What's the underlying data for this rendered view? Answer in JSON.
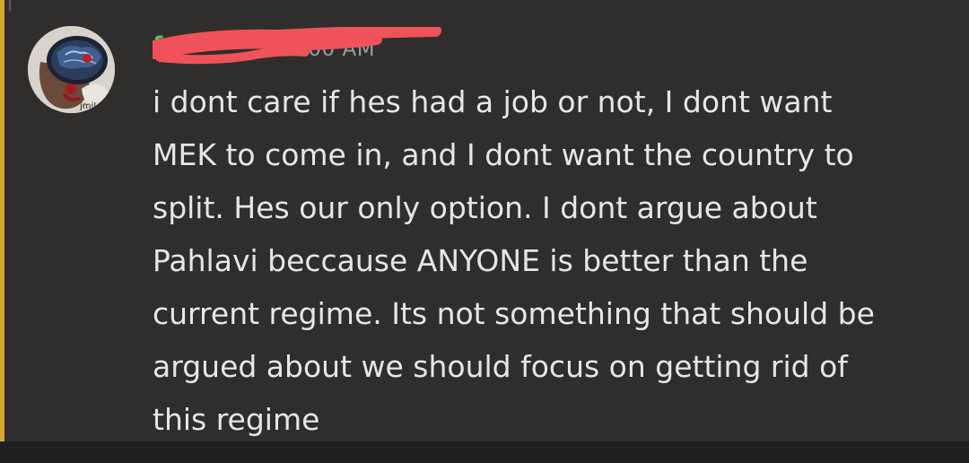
{
  "message": {
    "username": "f",
    "timestamp": "4:00 AM",
    "avatar_icon": "avatar-brain-artwork",
    "avatar_overlay_text": "jmiI",
    "text_lines": [
      "i dont care if hes had a job or not,  I dont want",
      "MEK to come in, and I dont want the country to",
      "split. Hes our only option. I dont argue about",
      "Pahlavi beccause ANYONE is better than the",
      "current regime. Its not something that should be",
      "argued about we should focus on getting rid of",
      "this regime"
    ]
  },
  "colors": {
    "background": "#2f2e2c",
    "mention_bar": "#d7a531",
    "username": "#5bbd63",
    "text": "#e6e6e8",
    "timestamp": "#9a9aa0",
    "redaction": "#f0525a"
  }
}
